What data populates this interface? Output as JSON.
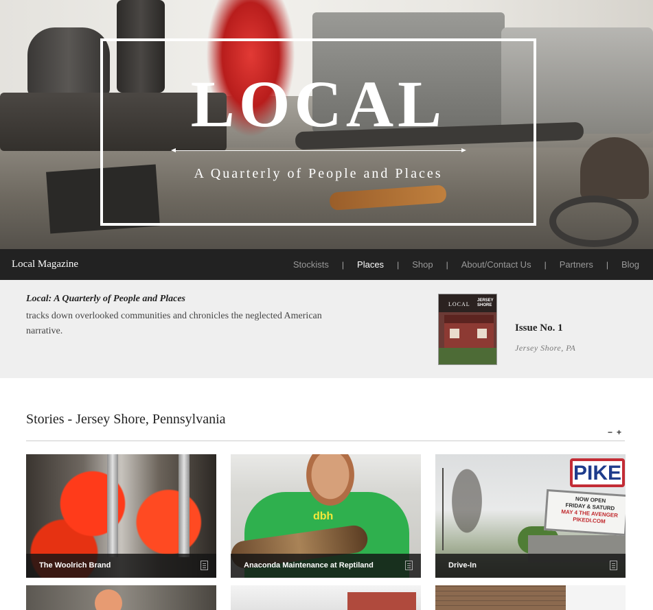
{
  "hero": {
    "title": "LOCAL",
    "subtitle": "A Quarterly of People and Places"
  },
  "nav": {
    "brand": "Local Magazine",
    "items": [
      {
        "label": "Stockists",
        "active": false
      },
      {
        "label": "Places",
        "active": true
      },
      {
        "label": "Shop",
        "active": false
      },
      {
        "label": "About/Contact Us",
        "active": false
      },
      {
        "label": "Partners",
        "active": false
      },
      {
        "label": "Blog",
        "active": false
      }
    ],
    "separator": "|"
  },
  "intro": {
    "title": "Local: A Quarterly of People and Places",
    "text": "tracks down overlooked communities and chronicles the neglected American narrative.",
    "cover": {
      "logo": "LOCAL",
      "badge_line1": "JERSEY",
      "badge_line2": "SHORE"
    },
    "issue": "Issue No. 1",
    "location": "Jersey Shore, PA"
  },
  "stories": {
    "title": "Stories - Jersey Shore, Pennsylvania",
    "zoom_out": "−",
    "zoom_in": "+",
    "cards": [
      {
        "caption": "The Woolrich Brand",
        "icon": "document-icon"
      },
      {
        "caption": "Anaconda Maintenance at Reptiland",
        "icon": "document-icon"
      },
      {
        "caption": "Drive-In",
        "icon": "document-icon"
      }
    ],
    "photo_text": {
      "shirt_logo": "dbh",
      "sign": "PIKE",
      "marquee_line1": "NOW OPEN",
      "marquee_line2": "FRIDAY & SATURD",
      "marquee_line3": "MAY 4 THE AVENGER",
      "marquee_line4": "PIKEDI.COM"
    }
  },
  "colors": {
    "nav_bg": "#222222",
    "intro_bg": "#efefef",
    "caption_bg": "#141414"
  }
}
